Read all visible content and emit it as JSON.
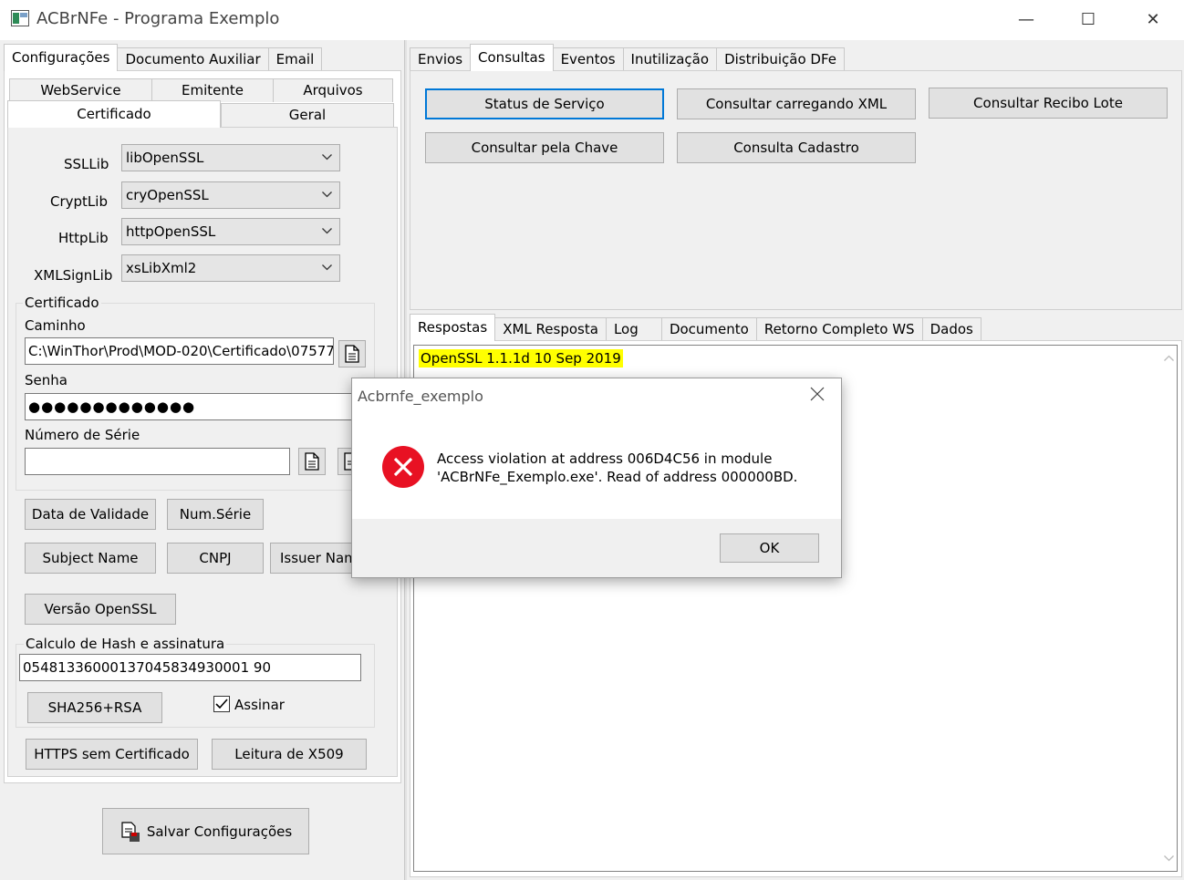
{
  "window": {
    "title": "ACBrNFe - Programa Exemplo",
    "minimize": "—",
    "maximize": "☐",
    "close": "✕"
  },
  "left_tabs": [
    "Configurações",
    "Documento Auxiliar",
    "Email"
  ],
  "config_subtabs_row1": [
    "WebService",
    "Emitente",
    "Arquivos"
  ],
  "config_subtabs_row2": [
    "Certificado",
    "Geral"
  ],
  "certificado": {
    "ssllib_label": "SSLLib",
    "ssllib_value": "libOpenSSL",
    "cryptlib_label": "CryptLib",
    "cryptlib_value": "cryOpenSSL",
    "httplib_label": "HttpLib",
    "httplib_value": "httpOpenSSL",
    "xmlsignlib_label": "XMLSignLib",
    "xmlsignlib_value": "xsLibXml2",
    "group_title": "Certificado",
    "caminho_label": "Caminho",
    "caminho_value": "C:\\WinThor\\Prod\\MOD-020\\Certificado\\07577",
    "senha_label": "Senha",
    "senha_value": "●●●●●●●●●●●●●",
    "numero_serie_label": "Número de Série",
    "numero_serie_value": "",
    "btn_data_validade": "Data de Validade",
    "btn_num_serie": "Num.Série",
    "btn_subject_name": "Subject Name",
    "btn_cnpj": "CNPJ",
    "btn_issuer_name": "Issuer Name",
    "btn_versao_openssl": "Versão OpenSSL",
    "hash_group_title": "Calculo de Hash e assinatura",
    "hash_value": "05481336000137045834930001 90",
    "btn_sha256": "SHA256+RSA",
    "assinar_label": "Assinar",
    "btn_https_sem_cert": "HTTPS sem Certificado",
    "btn_leitura_x509": "Leitura de X509",
    "btn_salvar": "Salvar Configurações"
  },
  "right_tabs": [
    "Envios",
    "Consultas",
    "Eventos",
    "Inutilização",
    "Distribuição DFe"
  ],
  "consultas": {
    "btn_status_servico": "Status de Serviço",
    "btn_consultar_xml": "Consultar carregando XML",
    "btn_consultar_recibo": "Consultar Recibo Lote",
    "btn_consultar_chave": "Consultar pela Chave",
    "btn_consulta_cadastro": "Consulta Cadastro"
  },
  "response_tabs": [
    "Respostas",
    "XML Resposta",
    "Log",
    "Documento",
    "Retorno Completo WS",
    "Dados"
  ],
  "response_text": "OpenSSL 1.1.1d  10 Sep 2019",
  "dialog": {
    "title": "Acbrnfe_exemplo",
    "message_line1": "Access violation at address 006D4C56 in module",
    "message_line2": "'ACBrNFe_Exemplo.exe'. Read of address 000000BD.",
    "ok_label": "OK"
  },
  "colors": {
    "highlight": "#ffff00",
    "error_red": "#e81123",
    "focus_blue": "#0078d7"
  }
}
